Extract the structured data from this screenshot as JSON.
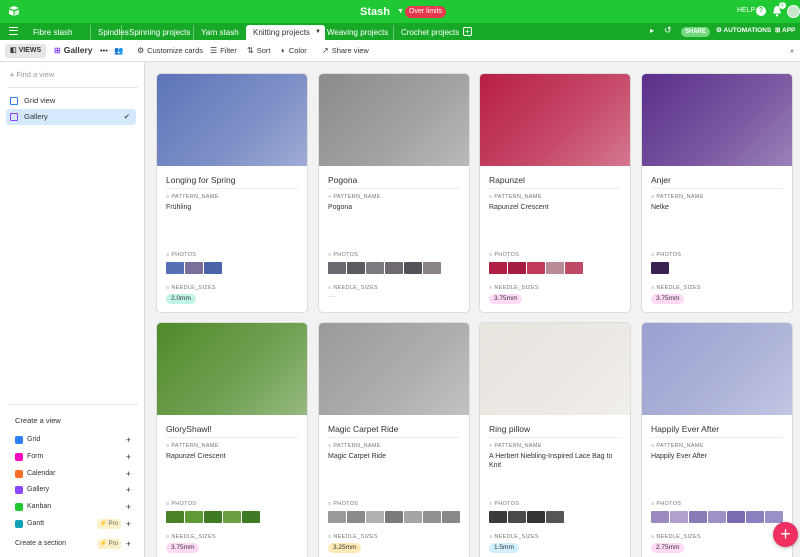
{
  "app": {
    "base_title": "Stash",
    "badge": "Over limits",
    "help": "HELP",
    "notification_count": "1"
  },
  "tabs": [
    {
      "label": "Fibre stash"
    },
    {
      "label": "Spindles"
    },
    {
      "label": "Spinning projects"
    },
    {
      "label": "Yarn stash"
    },
    {
      "label": "Knitting projects"
    },
    {
      "label": "Weaving projects"
    },
    {
      "label": "Crochet projects"
    }
  ],
  "tabbar_right": {
    "share": "SHARE",
    "automations": "AUTOMATIONS",
    "apps": "APP"
  },
  "toolbar": {
    "views": "VIEWS",
    "current_view": "Gallery",
    "more": "•••",
    "customize": "Customize cards",
    "filter": "Filter",
    "sort": "Sort",
    "color": "Color",
    "share_view": "Share view"
  },
  "sidebar": {
    "find_placeholder": "Find a view",
    "views": [
      {
        "label": "Grid view"
      },
      {
        "label": "Gallery"
      }
    ],
    "create_title": "Create a view",
    "create_items": [
      {
        "label": "Grid",
        "color": "#2d7ff9"
      },
      {
        "label": "Form",
        "color": "#ff08c2"
      },
      {
        "label": "Calendar",
        "color": "#ff6f2c"
      },
      {
        "label": "Gallery",
        "color": "#8b46ff"
      },
      {
        "label": "Kanban",
        "color": "#20c933"
      },
      {
        "label": "Gantt",
        "color": "#11a1b8",
        "pro": "Pro"
      }
    ],
    "section": "Create a section",
    "section_pro": "Pro"
  },
  "field_labels": {
    "pattern": "PATTERN_NAME",
    "photos": "PHOTOS",
    "needle": "NEEDLE_SIZES"
  },
  "cards": [
    {
      "title": "Longing for Spring",
      "pattern": "Frühling",
      "needle": "2.0mm",
      "needle_color": "#c2f5e9",
      "image_color": "#5d74b8",
      "thumbs": [
        "#5570b5",
        "#7a6f9a",
        "#4b63a8"
      ]
    },
    {
      "title": "Pogona",
      "pattern": "Pogona",
      "needle": "",
      "needle_color": "",
      "image_color": "#8d8a8c",
      "thumbs": [
        "#6b6870",
        "#5e5b60",
        "#7c7a7e",
        "#6f6a70",
        "#55525a",
        "#8a8489"
      ]
    },
    {
      "title": "Rapunzel",
      "pattern": "Rapunzel Crescent",
      "needle": "3.75mm",
      "needle_color": "#ffdaf6",
      "image_color": "#b81e45",
      "thumbs": [
        "#b02045",
        "#a51c40",
        "#c03a5a",
        "#b88a95",
        "#c04a66"
      ]
    },
    {
      "title": "Anjer",
      "pattern": "Nelke",
      "needle": "3.75mm",
      "needle_color": "#ffdaf6",
      "image_color": "#5a2f8a",
      "thumbs": [
        "#3a2050"
      ]
    },
    {
      "title": "GloryShawl!",
      "pattern": "Rapunzel Crescent",
      "needle": "3.75mm",
      "needle_color": "#ffdaf6",
      "image_color": "#4f8a2a",
      "thumbs": [
        "#4a8028",
        "#5f9a35",
        "#407a25",
        "#6aa040",
        "#3f7a26"
      ]
    },
    {
      "title": "Magic Carpet Ride",
      "pattern": "Magic Carpet Ride",
      "needle": "3.25mm",
      "needle_color": "#ffeab6",
      "image_color": "#9a9a9a",
      "thumbs": [
        "#9a9a9a",
        "#8a8a8a",
        "#b0b0b0",
        "#7a7a7a",
        "#a5a5a5",
        "#909090",
        "#888888"
      ]
    },
    {
      "title": "Ring pillow",
      "pattern": "A Herbert Niebling-Inspired Lace Bag to Knit",
      "needle": "1.5mm",
      "needle_color": "#d0f0fd",
      "image_color": "#e8e4de",
      "thumbs": [
        "#3a3a3a",
        "#4a4a4a",
        "#333333",
        "#555555"
      ]
    },
    {
      "title": "Happily Ever After",
      "pattern": "Happily Ever After",
      "needle": "2.75mm",
      "needle_color": "#ffdaf6",
      "image_color": "#9aa0d0",
      "thumbs": [
        "#9a8ac0",
        "#b0a0d0",
        "#8a7ab8",
        "#a090c8",
        "#7a6ab0",
        "#8a80c0",
        "#9a90c8"
      ]
    }
  ],
  "fab": "+"
}
